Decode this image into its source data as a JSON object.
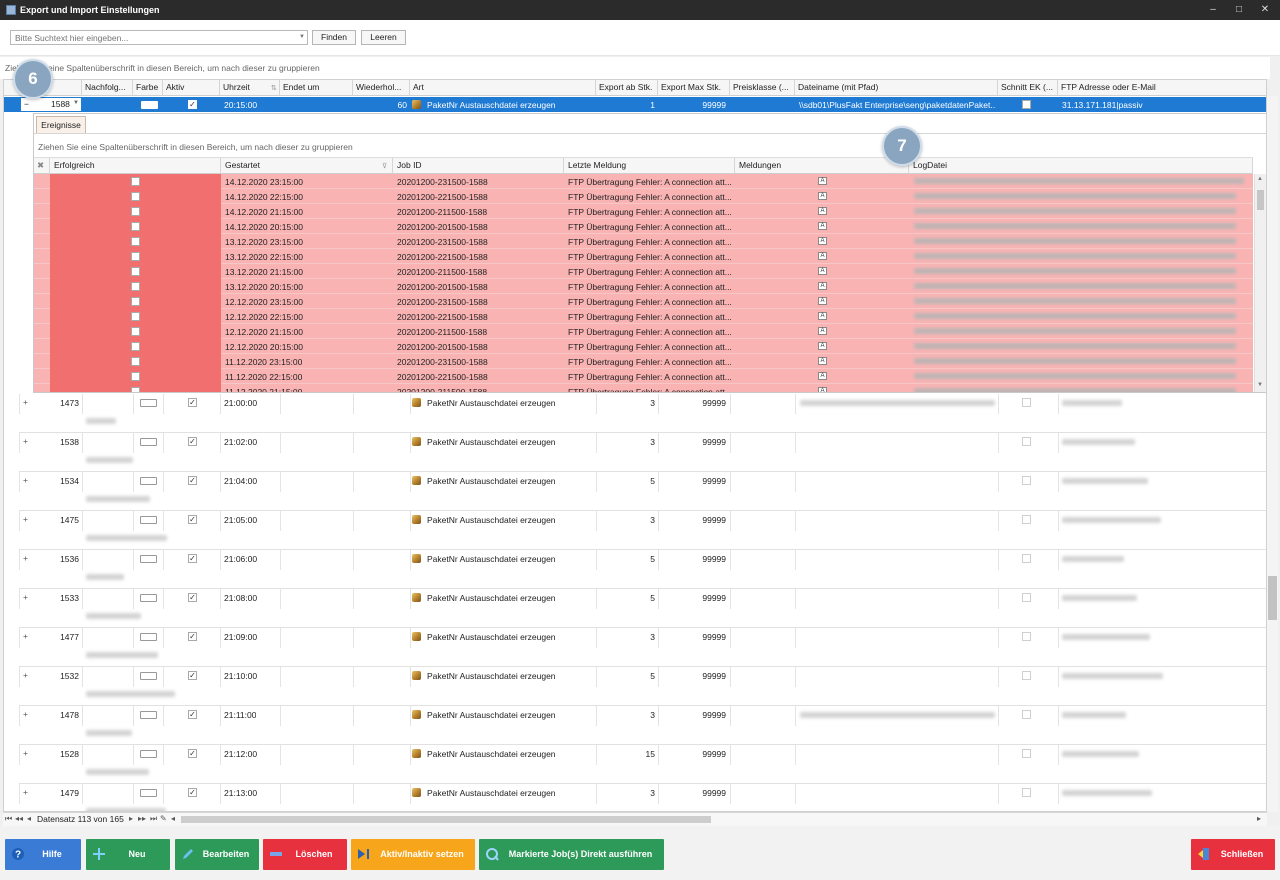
{
  "window": {
    "title": "Export und Import Einstellungen",
    "min": "‒",
    "max": "□",
    "close": "✕"
  },
  "search": {
    "placeholder": "Bitte Suchtext hier eingeben...",
    "find": "Finden",
    "clear": "Leeren"
  },
  "group_hint": "Ziehen Sie eine Spaltenüberschrift in diesen Bereich, um nach dieser zu gruppieren",
  "columns": [
    "Nachfolg...",
    "Farbe",
    "Aktiv",
    "Uhrzeit",
    "Endet um",
    "Wiederhol...",
    "Art",
    "Export ab Stk.",
    "Export Max Stk.",
    "Preisklasse (...",
    "Dateiname (mit Pfad)",
    "Schnitt EK (...",
    "FTP Adresse oder E-Mail"
  ],
  "selected_row": {
    "id": "1588",
    "time": "20:15:00",
    "repeat": "60",
    "art": "PaketNr Austauschdatei erzeugen",
    "export_ab": "1",
    "export_max": "99999",
    "file": "\\\\sdb01\\PlusFakt Enterprise\\seng\\paketdatenPaket...",
    "ftp": "31.13.171.181|passiv"
  },
  "detail": {
    "tab": "Ereignisse",
    "group_hint": "Ziehen Sie eine Spaltenüberschrift in diesen Bereich, um nach dieser zu gruppieren",
    "columns": [
      "Erfolgreich",
      "Gestartet",
      "Job ID",
      "Letzte Meldung",
      "Meldungen",
      "LogDatei"
    ],
    "rows": [
      {
        "start": "14.12.2020 23:15:00",
        "job": "20201200-231500-1588",
        "msg": "FTP Übertragung Fehler: A connection att..."
      },
      {
        "start": "14.12.2020 22:15:00",
        "job": "20201200-221500-1588",
        "msg": "FTP Übertragung Fehler: A connection att..."
      },
      {
        "start": "14.12.2020 21:15:00",
        "job": "20201200-211500-1588",
        "msg": "FTP Übertragung Fehler: A connection att..."
      },
      {
        "start": "14.12.2020 20:15:00",
        "job": "20201200-201500-1588",
        "msg": "FTP Übertragung Fehler: A connection att..."
      },
      {
        "start": "13.12.2020 23:15:00",
        "job": "20201200-231500-1588",
        "msg": "FTP Übertragung Fehler: A connection att..."
      },
      {
        "start": "13.12.2020 22:15:00",
        "job": "20201200-221500-1588",
        "msg": "FTP Übertragung Fehler: A connection att..."
      },
      {
        "start": "13.12.2020 21:15:00",
        "job": "20201200-211500-1588",
        "msg": "FTP Übertragung Fehler: A connection att..."
      },
      {
        "start": "13.12.2020 20:15:00",
        "job": "20201200-201500-1588",
        "msg": "FTP Übertragung Fehler: A connection att..."
      },
      {
        "start": "12.12.2020 23:15:00",
        "job": "20201200-231500-1588",
        "msg": "FTP Übertragung Fehler: A connection att..."
      },
      {
        "start": "12.12.2020 22:15:00",
        "job": "20201200-221500-1588",
        "msg": "FTP Übertragung Fehler: A connection att..."
      },
      {
        "start": "12.12.2020 21:15:00",
        "job": "20201200-211500-1588",
        "msg": "FTP Übertragung Fehler: A connection att..."
      },
      {
        "start": "12.12.2020 20:15:00",
        "job": "20201200-201500-1588",
        "msg": "FTP Übertragung Fehler: A connection att..."
      },
      {
        "start": "11.12.2020 23:15:00",
        "job": "20201200-231500-1588",
        "msg": "FTP Übertragung Fehler: A connection att..."
      },
      {
        "start": "11.12.2020 22:15:00",
        "job": "20201200-221500-1588",
        "msg": "FTP Übertragung Fehler: A connection att..."
      },
      {
        "start": "11.12.2020 21:15:00",
        "job": "20201200-211500-1588",
        "msg": "FTP Übertragung Fehler: A connection att..."
      }
    ]
  },
  "rows": [
    {
      "id": "1473",
      "time": "21:00:00",
      "art": "PaketNr Austauschdatei erzeugen",
      "export_ab": "3",
      "export_max": "99999",
      "file_blur": true
    },
    {
      "id": "1538",
      "time": "21:02:00",
      "art": "PaketNr Austauschdatei erzeugen",
      "export_ab": "3",
      "export_max": "99999",
      "file_blur": false
    },
    {
      "id": "1534",
      "time": "21:04:00",
      "art": "PaketNr Austauschdatei erzeugen",
      "export_ab": "5",
      "export_max": "99999",
      "file_blur": false
    },
    {
      "id": "1475",
      "time": "21:05:00",
      "art": "PaketNr Austauschdatei erzeugen",
      "export_ab": "3",
      "export_max": "99999",
      "file_blur": false
    },
    {
      "id": "1536",
      "time": "21:06:00",
      "art": "PaketNr Austauschdatei erzeugen",
      "export_ab": "5",
      "export_max": "99999",
      "file_blur": false
    },
    {
      "id": "1533",
      "time": "21:08:00",
      "art": "PaketNr Austauschdatei erzeugen",
      "export_ab": "5",
      "export_max": "99999",
      "file_blur": false
    },
    {
      "id": "1477",
      "time": "21:09:00",
      "art": "PaketNr Austauschdatei erzeugen",
      "export_ab": "3",
      "export_max": "99999",
      "file_blur": false
    },
    {
      "id": "1532",
      "time": "21:10:00",
      "art": "PaketNr Austauschdatei erzeugen",
      "export_ab": "5",
      "export_max": "99999",
      "file_blur": false
    },
    {
      "id": "1478",
      "time": "21:11:00",
      "art": "PaketNr Austauschdatei erzeugen",
      "export_ab": "3",
      "export_max": "99999",
      "file_blur": true
    },
    {
      "id": "1528",
      "time": "21:12:00",
      "art": "PaketNr Austauschdatei erzeugen",
      "export_ab": "15",
      "export_max": "99999",
      "file_blur": false
    },
    {
      "id": "1479",
      "time": "21:13:00",
      "art": "PaketNr Austauschdatei erzeugen",
      "export_ab": "3",
      "export_max": "99999",
      "file_blur": false
    }
  ],
  "navigator": {
    "record": "Datensatz 113 von 165"
  },
  "buttons": [
    {
      "label": "Hilfe",
      "color": "#3a7bd5",
      "icon": "help-icon"
    },
    {
      "label": "Neu",
      "color": "#2e9a5a",
      "icon": "add-icon"
    },
    {
      "label": "Bearbeiten",
      "color": "#2e9a5a",
      "icon": "edit-icon"
    },
    {
      "label": "Löschen",
      "color": "#e8313f",
      "icon": "delete-icon"
    },
    {
      "label": "Aktiv/Inaktiv setzen",
      "color": "#f7a51b",
      "icon": "toggle-icon"
    },
    {
      "label": "Markierte Job(s) Direkt ausführen",
      "color": "#2e9a5a",
      "icon": "run-icon"
    },
    {
      "label": "Schließen",
      "color": "#e8313f",
      "icon": "exit-icon"
    }
  ],
  "badges": [
    "6",
    "7"
  ]
}
